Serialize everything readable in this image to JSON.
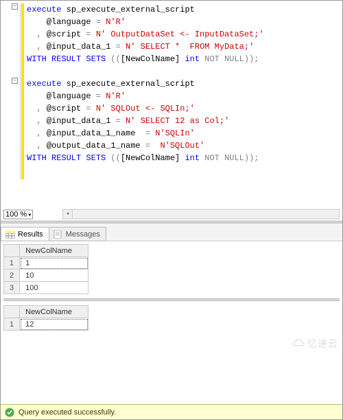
{
  "zoom": {
    "value": "100 %"
  },
  "code": {
    "lines": [
      {
        "t": [
          {
            "c": "kw",
            "v": "execute"
          },
          {
            "c": "",
            "v": " sp_execute_external_script"
          }
        ]
      },
      {
        "t": [
          {
            "c": "",
            "v": "    @language "
          },
          {
            "c": "op",
            "v": "="
          },
          {
            "c": "",
            "v": " "
          },
          {
            "c": "str",
            "v": "N'R'"
          }
        ]
      },
      {
        "t": [
          {
            "c": "op",
            "v": "  , "
          },
          {
            "c": "",
            "v": "@script "
          },
          {
            "c": "op",
            "v": "="
          },
          {
            "c": "",
            "v": " "
          },
          {
            "c": "str",
            "v": "N' OutputDataSet <- InputDataSet;'"
          }
        ]
      },
      {
        "t": [
          {
            "c": "op",
            "v": "  , "
          },
          {
            "c": "",
            "v": "@input_data_1 "
          },
          {
            "c": "op",
            "v": "="
          },
          {
            "c": "",
            "v": " "
          },
          {
            "c": "str",
            "v": "N' SELECT *  FROM MyData;'"
          }
        ]
      },
      {
        "t": [
          {
            "c": "kw",
            "v": "WITH RESULT SETS "
          },
          {
            "c": "op",
            "v": "(("
          },
          {
            "c": "",
            "v": "[NewColName] "
          },
          {
            "c": "kw",
            "v": "int"
          },
          {
            "c": "",
            "v": " "
          },
          {
            "c": "gray",
            "v": "NOT"
          },
          {
            "c": "",
            "v": " "
          },
          {
            "c": "gray",
            "v": "NULL"
          },
          {
            "c": "op",
            "v": "));"
          }
        ]
      },
      {
        "t": [
          {
            "c": "",
            "v": ""
          }
        ]
      },
      {
        "t": [
          {
            "c": "kw",
            "v": "execute"
          },
          {
            "c": "",
            "v": " sp_execute_external_script"
          }
        ]
      },
      {
        "t": [
          {
            "c": "",
            "v": "    @language "
          },
          {
            "c": "op",
            "v": "="
          },
          {
            "c": "",
            "v": " "
          },
          {
            "c": "str",
            "v": "N'R'"
          }
        ]
      },
      {
        "t": [
          {
            "c": "op",
            "v": "  , "
          },
          {
            "c": "",
            "v": "@script "
          },
          {
            "c": "op",
            "v": "="
          },
          {
            "c": "",
            "v": " "
          },
          {
            "c": "str",
            "v": "N' SQLOut <- SQLIn;'"
          }
        ]
      },
      {
        "t": [
          {
            "c": "op",
            "v": "  , "
          },
          {
            "c": "",
            "v": "@input_data_1 "
          },
          {
            "c": "op",
            "v": "="
          },
          {
            "c": "",
            "v": " "
          },
          {
            "c": "str",
            "v": "N' SELECT 12 as Col;'"
          }
        ]
      },
      {
        "t": [
          {
            "c": "op",
            "v": "  , "
          },
          {
            "c": "",
            "v": "@input_data_1_name  "
          },
          {
            "c": "op",
            "v": "="
          },
          {
            "c": "",
            "v": " "
          },
          {
            "c": "str",
            "v": "N'SQLIn'"
          }
        ]
      },
      {
        "t": [
          {
            "c": "op",
            "v": "  , "
          },
          {
            "c": "",
            "v": "@output_data_1_name "
          },
          {
            "c": "op",
            "v": "="
          },
          {
            "c": "",
            "v": "  "
          },
          {
            "c": "str",
            "v": "N'SQLOut'"
          }
        ]
      },
      {
        "t": [
          {
            "c": "kw",
            "v": "WITH RESULT SETS "
          },
          {
            "c": "op",
            "v": "(("
          },
          {
            "c": "",
            "v": "[NewColName] "
          },
          {
            "c": "kw",
            "v": "int"
          },
          {
            "c": "",
            "v": " "
          },
          {
            "c": "gray",
            "v": "NOT"
          },
          {
            "c": "",
            "v": " "
          },
          {
            "c": "gray",
            "v": "NULL"
          },
          {
            "c": "op",
            "v": "));"
          }
        ]
      }
    ]
  },
  "tabs": {
    "results": "Results",
    "messages": "Messages"
  },
  "grid1": {
    "header": "NewColName",
    "rows": [
      {
        "n": "1",
        "v": "1"
      },
      {
        "n": "2",
        "v": "10"
      },
      {
        "n": "3",
        "v": "100"
      }
    ]
  },
  "grid2": {
    "header": "NewColName",
    "rows": [
      {
        "n": "1",
        "v": "12"
      }
    ]
  },
  "status": {
    "text": "Query executed successfully."
  },
  "watermark": "亿速云"
}
